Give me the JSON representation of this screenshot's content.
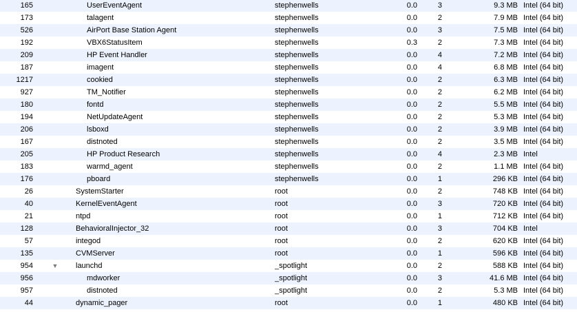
{
  "processes": [
    {
      "pid": "165",
      "name": "UserEventAgent",
      "user": "stephenwells",
      "cpu": "0.0",
      "threads": "3",
      "memory": "9.3 MB",
      "kind": "Intel (64 bit)",
      "depth": 2
    },
    {
      "pid": "173",
      "name": "talagent",
      "user": "stephenwells",
      "cpu": "0.0",
      "threads": "2",
      "memory": "7.9 MB",
      "kind": "Intel (64 bit)",
      "depth": 2
    },
    {
      "pid": "526",
      "name": "AirPort Base Station Agent",
      "user": "stephenwells",
      "cpu": "0.0",
      "threads": "3",
      "memory": "7.5 MB",
      "kind": "Intel (64 bit)",
      "depth": 2
    },
    {
      "pid": "192",
      "name": "VBX6StatusItem",
      "user": "stephenwells",
      "cpu": "0.3",
      "threads": "2",
      "memory": "7.3 MB",
      "kind": "Intel (64 bit)",
      "depth": 2
    },
    {
      "pid": "209",
      "name": "HP Event Handler",
      "user": "stephenwells",
      "cpu": "0.0",
      "threads": "4",
      "memory": "7.2 MB",
      "kind": "Intel (64 bit)",
      "depth": 2
    },
    {
      "pid": "187",
      "name": "imagent",
      "user": "stephenwells",
      "cpu": "0.0",
      "threads": "4",
      "memory": "6.8 MB",
      "kind": "Intel (64 bit)",
      "depth": 2
    },
    {
      "pid": "1217",
      "name": "cookied",
      "user": "stephenwells",
      "cpu": "0.0",
      "threads": "2",
      "memory": "6.3 MB",
      "kind": "Intel (64 bit)",
      "depth": 2
    },
    {
      "pid": "927",
      "name": "TM_Notifier",
      "user": "stephenwells",
      "cpu": "0.0",
      "threads": "2",
      "memory": "6.2 MB",
      "kind": "Intel (64 bit)",
      "depth": 2
    },
    {
      "pid": "180",
      "name": "fontd",
      "user": "stephenwells",
      "cpu": "0.0",
      "threads": "2",
      "memory": "5.5 MB",
      "kind": "Intel (64 bit)",
      "depth": 2
    },
    {
      "pid": "194",
      "name": "NetUpdateAgent",
      "user": "stephenwells",
      "cpu": "0.0",
      "threads": "2",
      "memory": "5.3 MB",
      "kind": "Intel (64 bit)",
      "depth": 2
    },
    {
      "pid": "206",
      "name": "lsboxd",
      "user": "stephenwells",
      "cpu": "0.0",
      "threads": "2",
      "memory": "3.9 MB",
      "kind": "Intel (64 bit)",
      "depth": 2
    },
    {
      "pid": "167",
      "name": "distnoted",
      "user": "stephenwells",
      "cpu": "0.0",
      "threads": "2",
      "memory": "3.5 MB",
      "kind": "Intel (64 bit)",
      "depth": 2
    },
    {
      "pid": "205",
      "name": "HP Product Research",
      "user": "stephenwells",
      "cpu": "0.0",
      "threads": "4",
      "memory": "2.3 MB",
      "kind": "Intel",
      "depth": 2
    },
    {
      "pid": "183",
      "name": "warmd_agent",
      "user": "stephenwells",
      "cpu": "0.0",
      "threads": "2",
      "memory": "1.1 MB",
      "kind": "Intel (64 bit)",
      "depth": 2
    },
    {
      "pid": "176",
      "name": "pboard",
      "user": "stephenwells",
      "cpu": "0.0",
      "threads": "1",
      "memory": "296 KB",
      "kind": "Intel (64 bit)",
      "depth": 2
    },
    {
      "pid": "26",
      "name": "SystemStarter",
      "user": "root",
      "cpu": "0.0",
      "threads": "2",
      "memory": "748 KB",
      "kind": "Intel (64 bit)",
      "depth": 1
    },
    {
      "pid": "40",
      "name": "KernelEventAgent",
      "user": "root",
      "cpu": "0.0",
      "threads": "3",
      "memory": "720 KB",
      "kind": "Intel (64 bit)",
      "depth": 1
    },
    {
      "pid": "21",
      "name": "ntpd",
      "user": "root",
      "cpu": "0.0",
      "threads": "1",
      "memory": "712 KB",
      "kind": "Intel (64 bit)",
      "depth": 1
    },
    {
      "pid": "128",
      "name": "BehavioralInjector_32",
      "user": "root",
      "cpu": "0.0",
      "threads": "3",
      "memory": "704 KB",
      "kind": "Intel",
      "depth": 1
    },
    {
      "pid": "57",
      "name": "integod",
      "user": "root",
      "cpu": "0.0",
      "threads": "2",
      "memory": "620 KB",
      "kind": "Intel (64 bit)",
      "depth": 1
    },
    {
      "pid": "135",
      "name": "CVMServer",
      "user": "root",
      "cpu": "0.0",
      "threads": "1",
      "memory": "596 KB",
      "kind": "Intel (64 bit)",
      "depth": 1
    },
    {
      "pid": "954",
      "name": "launchd",
      "user": "_spotlight",
      "cpu": "0.0",
      "threads": "2",
      "memory": "588 KB",
      "kind": "Intel (64 bit)",
      "depth": 1,
      "expanded": true
    },
    {
      "pid": "956",
      "name": "mdworker",
      "user": "_spotlight",
      "cpu": "0.0",
      "threads": "3",
      "memory": "41.6 MB",
      "kind": "Intel (64 bit)",
      "depth": 2
    },
    {
      "pid": "957",
      "name": "distnoted",
      "user": "_spotlight",
      "cpu": "0.0",
      "threads": "2",
      "memory": "5.3 MB",
      "kind": "Intel (64 bit)",
      "depth": 2
    },
    {
      "pid": "44",
      "name": "dynamic_pager",
      "user": "root",
      "cpu": "0.0",
      "threads": "1",
      "memory": "480 KB",
      "kind": "Intel (64 bit)",
      "depth": 1
    }
  ],
  "icons": {
    "disclosure_expanded": "▼"
  },
  "colors": {
    "row_alt": "#edf3fe",
    "row_base": "#ffffff",
    "disclosure": "#7a7a7a"
  }
}
